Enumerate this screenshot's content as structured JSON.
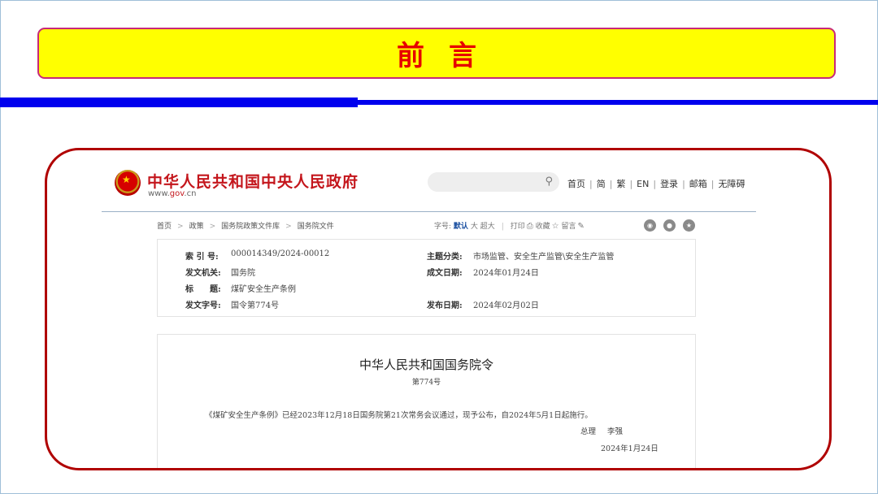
{
  "slide": {
    "title": "前言",
    "colors": {
      "banner_bg": "#ffff00",
      "banner_border": "#c8287a",
      "title_text": "#e60000",
      "rule": "#0000ee",
      "frame_border": "#b00000"
    }
  },
  "site": {
    "name": "中华人民共和国中央人民政府",
    "url_prefix": "www.",
    "url_domain": "gov",
    "url_suffix": ".cn",
    "emblem_icon": "national-emblem-icon",
    "search": {
      "placeholder": "",
      "icon": "search-icon"
    },
    "nav": [
      "首页",
      "简",
      "繁",
      "EN",
      "登录",
      "邮箱",
      "无障碍"
    ]
  },
  "breadcrumb": [
    "首页",
    "政策",
    "国务院政策文件库",
    "国务院文件"
  ],
  "tools": {
    "font_label": "字号:",
    "font_default": "默认",
    "font_large": "大",
    "font_xlarge": "超大",
    "print": "打印",
    "collect": "收藏",
    "comment": "留言",
    "share_icons": [
      "weibo-icon",
      "wechat-icon",
      "favorite-icon"
    ]
  },
  "meta": {
    "index_label": "索 引 号:",
    "index_value": "000014349/2024-00012",
    "topic_label": "主题分类:",
    "topic_value": "市场监管、安全生产监管\\安全生产监管",
    "issuer_label": "发文机关:",
    "issuer_value": "国务院",
    "written_label": "成文日期:",
    "written_value": "2024年01月24日",
    "title_label": "标　　题:",
    "title_value": "煤矿安全生产条例",
    "docno_label": "发文字号:",
    "docno_value": "国令第774号",
    "published_label": "发布日期:",
    "published_value": "2024年02月02日"
  },
  "document": {
    "heading": "中华人民共和国国务院令",
    "number": "第774号",
    "body": "《煤矿安全生产条例》已经2023年12月18日国务院第21次常务会议通过，现予公布，自2024年5月1日起施行。",
    "sign_title": "总理",
    "sign_name": "李强",
    "date": "2024年1月24日"
  }
}
